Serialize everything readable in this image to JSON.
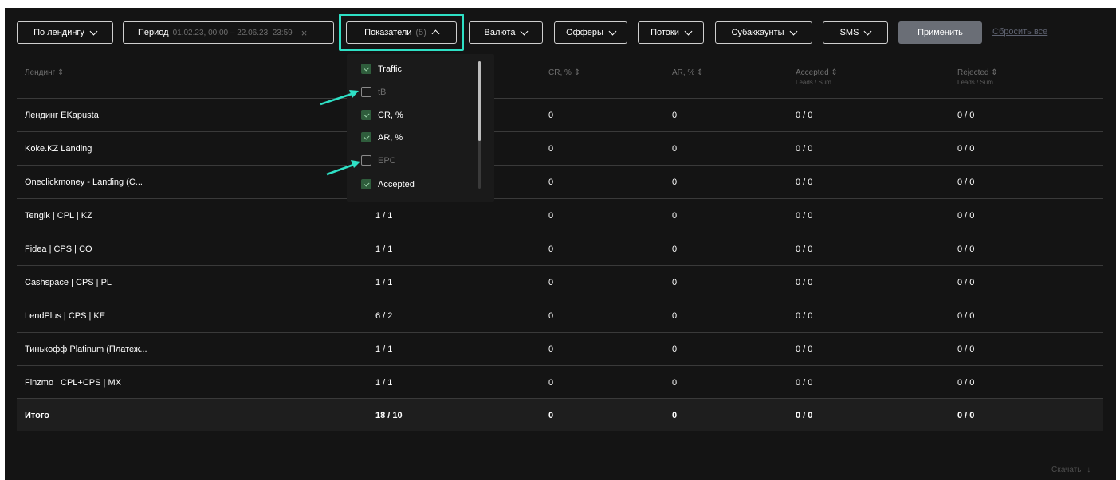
{
  "toolbar": {
    "landing_filter": "По лендингу",
    "period_label": "Период",
    "period_value": "01.02.23, 00:00 – 22.06.23, 23:59",
    "period_clear": "×",
    "metrics_label": "Показатели",
    "metrics_count": "(5)",
    "currency": "Валюта",
    "offers": "Офферы",
    "streams": "Потоки",
    "subaccounts": "Субаккаунты",
    "sms": "SMS",
    "apply": "Применить",
    "reset": "Сбросить все"
  },
  "highlight_color": "#2ee0c5",
  "table": {
    "headers": [
      {
        "label": "Лендинг",
        "sort": "⇕"
      },
      {
        "label": "CR, %",
        "sort": "⇕"
      },
      {
        "label": "AR, %",
        "sort": "⇕"
      },
      {
        "label": "Accepted",
        "sort": "⇕",
        "sub": "Leads / Sum"
      },
      {
        "label": "Rejected",
        "sort": "⇕",
        "sub": "Leads / Sum"
      }
    ],
    "rows": [
      {
        "name": "Лендинг EKapusta",
        "traffic": "",
        "cr": "0",
        "ar": "0",
        "accepted": "0 / 0",
        "rejected": "0 / 0"
      },
      {
        "name": "Koke.KZ Landing",
        "traffic": "",
        "cr": "0",
        "ar": "0",
        "accepted": "0 / 0",
        "rejected": "0 / 0"
      },
      {
        "name": "Oneclickmoney - Landing (C...",
        "traffic": "",
        "cr": "0",
        "ar": "0",
        "accepted": "0 / 0",
        "rejected": "0 / 0"
      },
      {
        "name": "Tengik | CPL | KZ",
        "traffic": "1 / 1",
        "cr": "0",
        "ar": "0",
        "accepted": "0 / 0",
        "rejected": "0 / 0"
      },
      {
        "name": "Fidea | CPS | CO",
        "traffic": "1 / 1",
        "cr": "0",
        "ar": "0",
        "accepted": "0 / 0",
        "rejected": "0 / 0"
      },
      {
        "name": "Cashspace | CPS | PL",
        "traffic": "1 / 1",
        "cr": "0",
        "ar": "0",
        "accepted": "0 / 0",
        "rejected": "0 / 0"
      },
      {
        "name": "LendPlus | CPS | KE",
        "traffic": "6 / 2",
        "cr": "0",
        "ar": "0",
        "accepted": "0 / 0",
        "rejected": "0 / 0"
      },
      {
        "name": "Тинькофф Platinum (Платеж...",
        "traffic": "1 / 1",
        "cr": "0",
        "ar": "0",
        "accepted": "0 / 0",
        "rejected": "0 / 0"
      },
      {
        "name": "Finzmo | CPL+CPS | MX",
        "traffic": "1 / 1",
        "cr": "0",
        "ar": "0",
        "accepted": "0 / 0",
        "rejected": "0 / 0"
      }
    ],
    "total": {
      "name": "Итого",
      "traffic": "18 / 10",
      "cr": "0",
      "ar": "0",
      "accepted": "0 / 0",
      "rejected": "0 / 0"
    }
  },
  "dropdown": {
    "options": [
      {
        "label": "Traffic",
        "checked": true
      },
      {
        "label": "tB",
        "checked": false
      },
      {
        "label": "CR, %",
        "checked": true
      },
      {
        "label": "AR, %",
        "checked": true
      },
      {
        "label": "EPC",
        "checked": false
      },
      {
        "label": "Accepted",
        "checked": true
      }
    ]
  },
  "footer": {
    "download": "Скачать"
  }
}
